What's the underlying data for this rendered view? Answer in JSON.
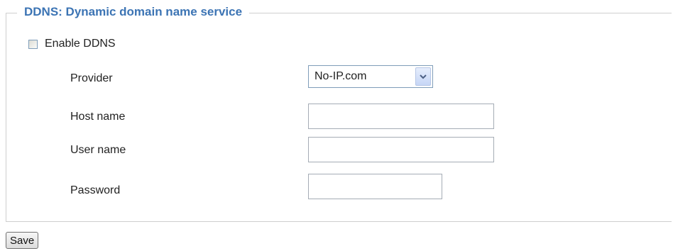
{
  "section": {
    "legend": "DDNS: Dynamic domain name service"
  },
  "enable": {
    "label": "Enable DDNS",
    "checked": false
  },
  "fields": {
    "provider_label": "Provider",
    "provider_value": "No-IP.com",
    "host_label": "Host name",
    "host_value": "",
    "user_label": "User name",
    "user_value": "",
    "password_label": "Password",
    "password_value": ""
  },
  "actions": {
    "save_label": "Save"
  },
  "icons": {
    "dropdown": "chevron-down-icon"
  },
  "colors": {
    "legend": "#3c74b4",
    "border": "#cfcfcf"
  }
}
